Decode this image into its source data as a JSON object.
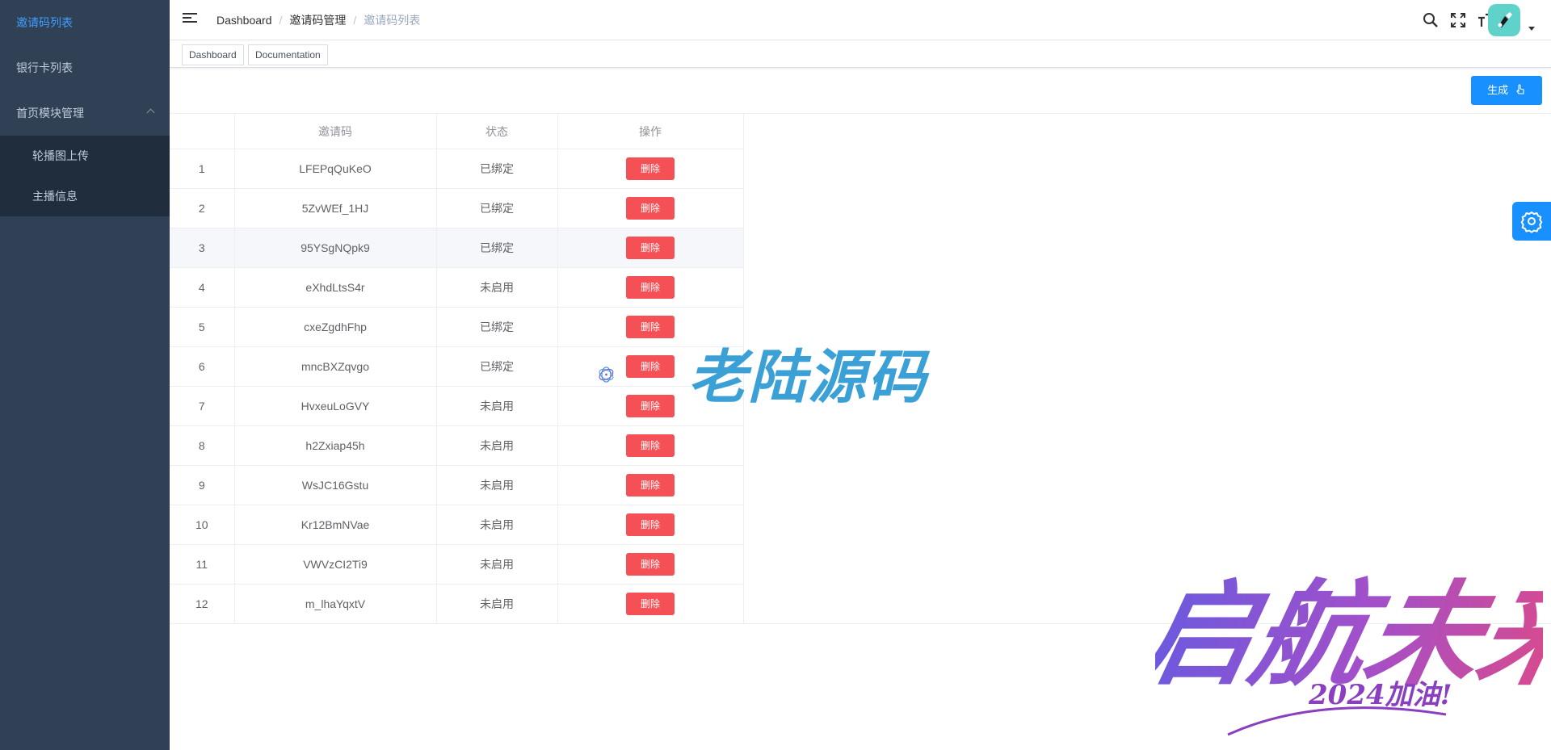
{
  "sidebar": {
    "items": [
      {
        "label": "邀请码列表"
      },
      {
        "label": "银行卡列表"
      },
      {
        "label": "首页模块管理"
      }
    ],
    "submenu": [
      {
        "label": "轮播图上传"
      },
      {
        "label": "主播信息"
      }
    ]
  },
  "navbar": {
    "breadcrumb": [
      "Dashboard",
      "邀请码管理",
      "邀请码列表"
    ],
    "separator": "/"
  },
  "tags": [
    "Dashboard",
    "Documentation"
  ],
  "toolbar": {
    "generate_label": "生成"
  },
  "table": {
    "headers": [
      "",
      "邀请码",
      "状态",
      "操作"
    ],
    "delete_label": "删除",
    "rows": [
      {
        "index": "1",
        "code": "LFEPqQuKeO",
        "status": "已绑定"
      },
      {
        "index": "2",
        "code": "5ZvWEf_1HJ",
        "status": "已绑定"
      },
      {
        "index": "3",
        "code": "95YSgNQpk9",
        "status": "已绑定"
      },
      {
        "index": "4",
        "code": "eXhdLtsS4r",
        "status": "未启用"
      },
      {
        "index": "5",
        "code": "cxeZgdhFhp",
        "status": "已绑定"
      },
      {
        "index": "6",
        "code": "mncBXZqvgo",
        "status": "已绑定"
      },
      {
        "index": "7",
        "code": "HvxeuLoGVY",
        "status": "未启用"
      },
      {
        "index": "8",
        "code": "h2Zxiap45h",
        "status": "未启用"
      },
      {
        "index": "9",
        "code": "WsJC16Gstu",
        "status": "未启用"
      },
      {
        "index": "10",
        "code": "Kr12BmNVae",
        "status": "未启用"
      },
      {
        "index": "11",
        "code": "VWVzCI2Ti9",
        "status": "未启用"
      },
      {
        "index": "12",
        "code": "m_lhaYqxtV",
        "status": "未启用"
      }
    ]
  },
  "watermark": {
    "text": "老陆源码",
    "corner_text": "启航未来",
    "corner_sub": "2024加油!"
  },
  "colors": {
    "sidebar_bg": "#304156",
    "accent": "#1890ff",
    "danger": "#f55056",
    "active": "#409eff"
  }
}
